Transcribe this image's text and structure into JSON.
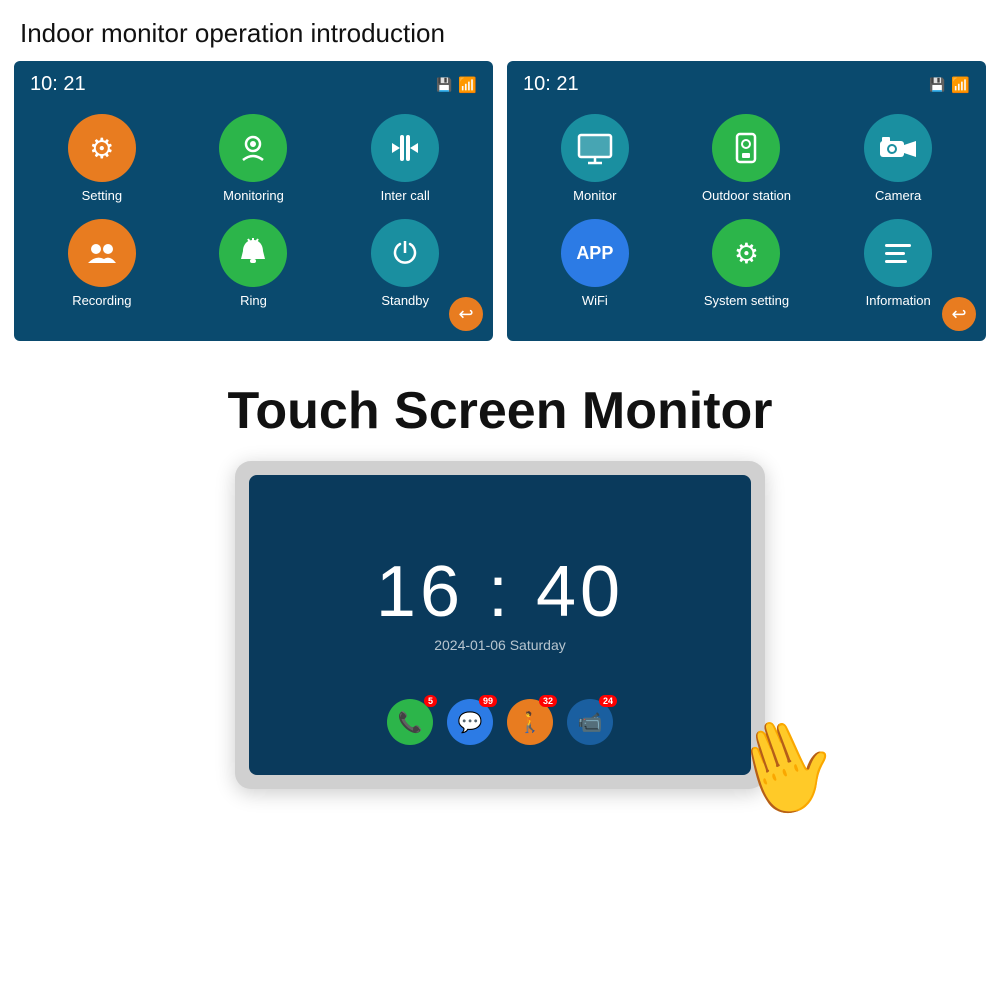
{
  "page": {
    "title": "Indoor monitor operation introduction"
  },
  "screen1": {
    "time": "10: 21",
    "icons": [
      {
        "label": "Setting",
        "color": "orange",
        "symbol": "⚙"
      },
      {
        "label": "Monitoring",
        "color": "green",
        "symbol": "📷"
      },
      {
        "label": "Inter call",
        "color": "teal",
        "symbol": "⇅"
      },
      {
        "label": "Recording",
        "color": "orange",
        "symbol": "👥"
      },
      {
        "label": "Ring",
        "color": "green",
        "symbol": "🔔"
      },
      {
        "label": "Standby",
        "color": "teal",
        "symbol": "⏻"
      }
    ]
  },
  "screen2": {
    "time": "10: 21",
    "icons": [
      {
        "label": "Monitor",
        "color": "teal",
        "symbol": "🖥"
      },
      {
        "label": "Outdoor station",
        "color": "green",
        "symbol": "📟"
      },
      {
        "label": "Camera",
        "color": "teal",
        "symbol": "📹"
      },
      {
        "label": "WiFi",
        "color": "blue-dark",
        "symbol": "APP"
      },
      {
        "label": "System setting",
        "color": "green",
        "symbol": "⚙"
      },
      {
        "label": "Information",
        "color": "teal",
        "symbol": "≡"
      }
    ]
  },
  "touchscreen": {
    "title": "Touch Screen Monitor",
    "clock": "16 : 40",
    "date": "2024-01-06  Saturday",
    "apps": [
      {
        "symbol": "📞",
        "color": "#2cb54a",
        "badge": "5"
      },
      {
        "symbol": "💬",
        "color": "#2c7be5",
        "badge": "99"
      },
      {
        "symbol": "🚶",
        "color": "#e87c20",
        "badge": "32"
      },
      {
        "symbol": "📹",
        "color": "#1a5fa0",
        "badge": "24"
      }
    ]
  }
}
